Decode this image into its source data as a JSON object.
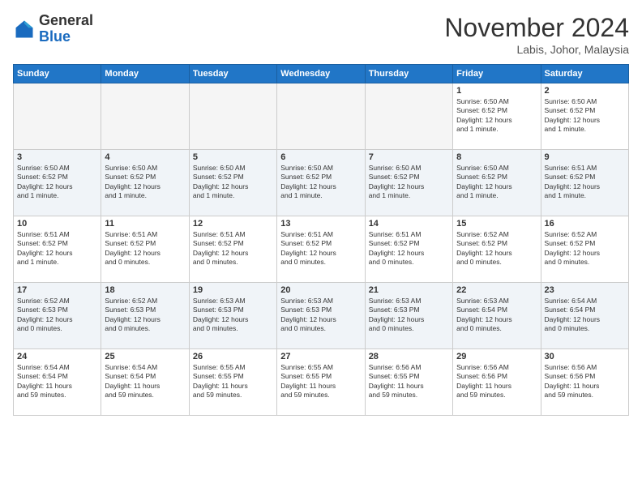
{
  "logo": {
    "general": "General",
    "blue": "Blue"
  },
  "header": {
    "month": "November 2024",
    "location": "Labis, Johor, Malaysia"
  },
  "weekdays": [
    "Sunday",
    "Monday",
    "Tuesday",
    "Wednesday",
    "Thursday",
    "Friday",
    "Saturday"
  ],
  "weeks": [
    [
      {
        "day": "",
        "text": ""
      },
      {
        "day": "",
        "text": ""
      },
      {
        "day": "",
        "text": ""
      },
      {
        "day": "",
        "text": ""
      },
      {
        "day": "",
        "text": ""
      },
      {
        "day": "1",
        "text": "Sunrise: 6:50 AM\nSunset: 6:52 PM\nDaylight: 12 hours\nand 1 minute."
      },
      {
        "day": "2",
        "text": "Sunrise: 6:50 AM\nSunset: 6:52 PM\nDaylight: 12 hours\nand 1 minute."
      }
    ],
    [
      {
        "day": "3",
        "text": "Sunrise: 6:50 AM\nSunset: 6:52 PM\nDaylight: 12 hours\nand 1 minute."
      },
      {
        "day": "4",
        "text": "Sunrise: 6:50 AM\nSunset: 6:52 PM\nDaylight: 12 hours\nand 1 minute."
      },
      {
        "day": "5",
        "text": "Sunrise: 6:50 AM\nSunset: 6:52 PM\nDaylight: 12 hours\nand 1 minute."
      },
      {
        "day": "6",
        "text": "Sunrise: 6:50 AM\nSunset: 6:52 PM\nDaylight: 12 hours\nand 1 minute."
      },
      {
        "day": "7",
        "text": "Sunrise: 6:50 AM\nSunset: 6:52 PM\nDaylight: 12 hours\nand 1 minute."
      },
      {
        "day": "8",
        "text": "Sunrise: 6:50 AM\nSunset: 6:52 PM\nDaylight: 12 hours\nand 1 minute."
      },
      {
        "day": "9",
        "text": "Sunrise: 6:51 AM\nSunset: 6:52 PM\nDaylight: 12 hours\nand 1 minute."
      }
    ],
    [
      {
        "day": "10",
        "text": "Sunrise: 6:51 AM\nSunset: 6:52 PM\nDaylight: 12 hours\nand 1 minute."
      },
      {
        "day": "11",
        "text": "Sunrise: 6:51 AM\nSunset: 6:52 PM\nDaylight: 12 hours\nand 0 minutes."
      },
      {
        "day": "12",
        "text": "Sunrise: 6:51 AM\nSunset: 6:52 PM\nDaylight: 12 hours\nand 0 minutes."
      },
      {
        "day": "13",
        "text": "Sunrise: 6:51 AM\nSunset: 6:52 PM\nDaylight: 12 hours\nand 0 minutes."
      },
      {
        "day": "14",
        "text": "Sunrise: 6:51 AM\nSunset: 6:52 PM\nDaylight: 12 hours\nand 0 minutes."
      },
      {
        "day": "15",
        "text": "Sunrise: 6:52 AM\nSunset: 6:52 PM\nDaylight: 12 hours\nand 0 minutes."
      },
      {
        "day": "16",
        "text": "Sunrise: 6:52 AM\nSunset: 6:52 PM\nDaylight: 12 hours\nand 0 minutes."
      }
    ],
    [
      {
        "day": "17",
        "text": "Sunrise: 6:52 AM\nSunset: 6:53 PM\nDaylight: 12 hours\nand 0 minutes."
      },
      {
        "day": "18",
        "text": "Sunrise: 6:52 AM\nSunset: 6:53 PM\nDaylight: 12 hours\nand 0 minutes."
      },
      {
        "day": "19",
        "text": "Sunrise: 6:53 AM\nSunset: 6:53 PM\nDaylight: 12 hours\nand 0 minutes."
      },
      {
        "day": "20",
        "text": "Sunrise: 6:53 AM\nSunset: 6:53 PM\nDaylight: 12 hours\nand 0 minutes."
      },
      {
        "day": "21",
        "text": "Sunrise: 6:53 AM\nSunset: 6:53 PM\nDaylight: 12 hours\nand 0 minutes."
      },
      {
        "day": "22",
        "text": "Sunrise: 6:53 AM\nSunset: 6:54 PM\nDaylight: 12 hours\nand 0 minutes."
      },
      {
        "day": "23",
        "text": "Sunrise: 6:54 AM\nSunset: 6:54 PM\nDaylight: 12 hours\nand 0 minutes."
      }
    ],
    [
      {
        "day": "24",
        "text": "Sunrise: 6:54 AM\nSunset: 6:54 PM\nDaylight: 11 hours\nand 59 minutes."
      },
      {
        "day": "25",
        "text": "Sunrise: 6:54 AM\nSunset: 6:54 PM\nDaylight: 11 hours\nand 59 minutes."
      },
      {
        "day": "26",
        "text": "Sunrise: 6:55 AM\nSunset: 6:55 PM\nDaylight: 11 hours\nand 59 minutes."
      },
      {
        "day": "27",
        "text": "Sunrise: 6:55 AM\nSunset: 6:55 PM\nDaylight: 11 hours\nand 59 minutes."
      },
      {
        "day": "28",
        "text": "Sunrise: 6:56 AM\nSunset: 6:55 PM\nDaylight: 11 hours\nand 59 minutes."
      },
      {
        "day": "29",
        "text": "Sunrise: 6:56 AM\nSunset: 6:56 PM\nDaylight: 11 hours\nand 59 minutes."
      },
      {
        "day": "30",
        "text": "Sunrise: 6:56 AM\nSunset: 6:56 PM\nDaylight: 11 hours\nand 59 minutes."
      }
    ]
  ]
}
